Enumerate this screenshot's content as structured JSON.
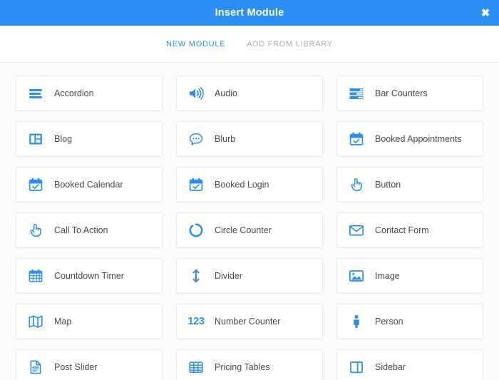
{
  "window": {
    "title": "Insert Module",
    "close_label": "✖",
    "header_color": "#2b8ef4",
    "accent_color": "#2b8ef4"
  },
  "tabs": [
    {
      "label": "New Module",
      "active": true
    },
    {
      "label": "Add From Library",
      "active": false
    }
  ],
  "modules": [
    {
      "label": "Accordion",
      "icon": "accordion-icon"
    },
    {
      "label": "Audio",
      "icon": "audio-icon"
    },
    {
      "label": "Bar Counters",
      "icon": "bar-counters-icon"
    },
    {
      "label": "Blog",
      "icon": "blog-icon"
    },
    {
      "label": "Blurb",
      "icon": "blurb-icon"
    },
    {
      "label": "Booked Appointments",
      "icon": "calendar-check-icon"
    },
    {
      "label": "Booked Calendar",
      "icon": "calendar-check-icon"
    },
    {
      "label": "Booked Login",
      "icon": "calendar-check-icon"
    },
    {
      "label": "Button",
      "icon": "pointing-hand-icon"
    },
    {
      "label": "Call To Action",
      "icon": "pointing-hand-icon"
    },
    {
      "label": "Circle Counter",
      "icon": "circle-counter-icon"
    },
    {
      "label": "Contact Form",
      "icon": "envelope-icon"
    },
    {
      "label": "Countdown Timer",
      "icon": "calendar-grid-icon"
    },
    {
      "label": "Divider",
      "icon": "vertical-arrow-icon"
    },
    {
      "label": "Image",
      "icon": "image-icon"
    },
    {
      "label": "Map",
      "icon": "map-icon"
    },
    {
      "label": "Number Counter",
      "icon": "number-123-icon",
      "icon_text": "123"
    },
    {
      "label": "Person",
      "icon": "person-icon"
    },
    {
      "label": "Post Slider",
      "icon": "document-icon"
    },
    {
      "label": "Pricing Tables",
      "icon": "table-grid-icon"
    },
    {
      "label": "Sidebar",
      "icon": "sidebar-columns-icon"
    }
  ]
}
